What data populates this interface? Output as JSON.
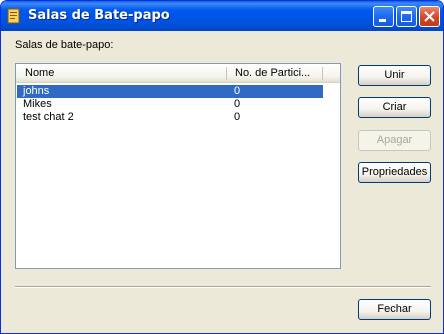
{
  "window": {
    "title": "Salas de Bate-papo",
    "icon": "document-icon"
  },
  "main": {
    "rooms_label": "Salas de bate-papo:",
    "columns": [
      "Nome",
      "No. de Partici..."
    ],
    "rows": [
      {
        "name": "johns",
        "participants": "0",
        "selected": true
      },
      {
        "name": "Mikes",
        "participants": "0",
        "selected": false
      },
      {
        "name": "test chat 2",
        "participants": "0",
        "selected": false
      }
    ]
  },
  "buttons": {
    "join": "Unir",
    "create": "Criar",
    "delete": "Apagar",
    "properties": "Propriedades",
    "close": "Fechar"
  },
  "colors": {
    "titlebar": "#0054E3",
    "selection": "#316AC5",
    "dialog_bg": "#ECE9D8"
  }
}
